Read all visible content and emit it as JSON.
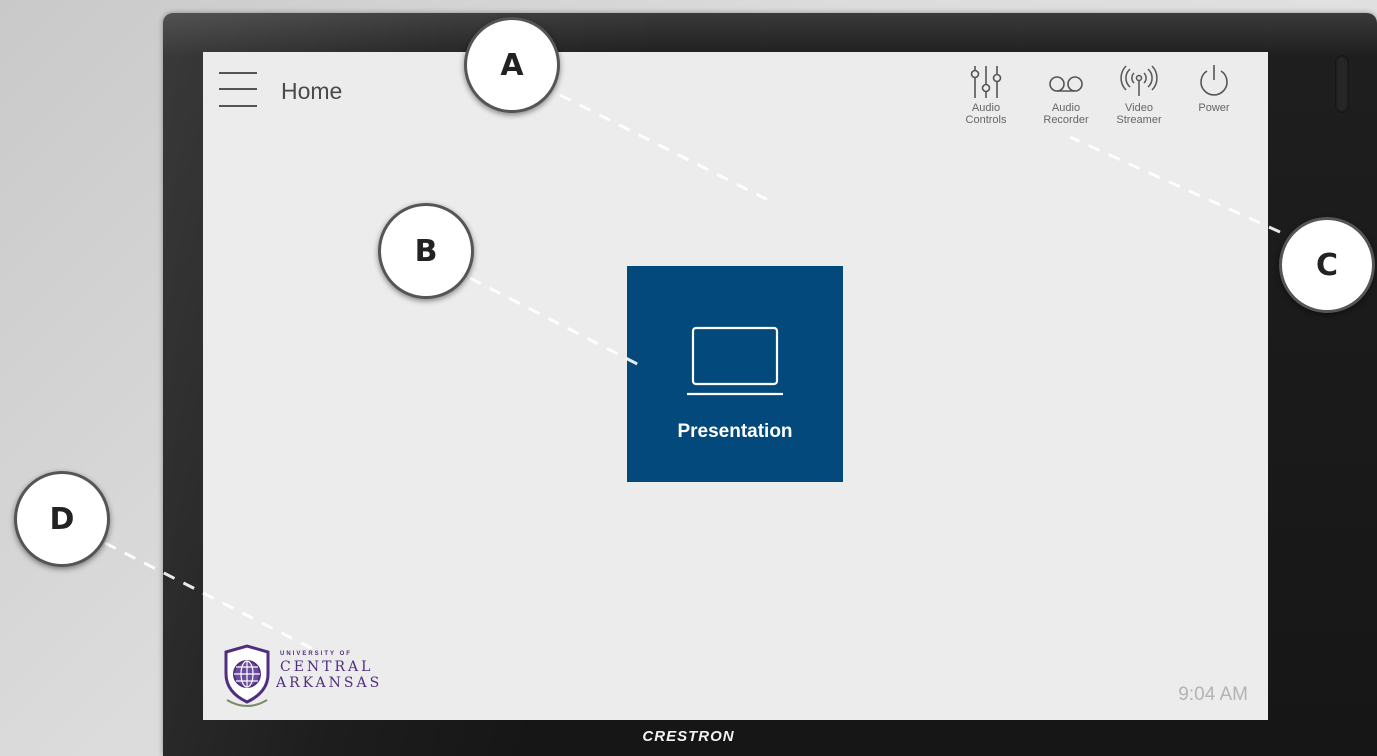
{
  "screen": {
    "title": "Home",
    "time": "9:04 AM",
    "primary_tile": {
      "label": "Presentation",
      "icon": "laptop-icon"
    },
    "top_controls": [
      {
        "label": "Audio\nControls",
        "icon": "sliders-icon"
      },
      {
        "label": "Audio\nRecorder",
        "icon": "voicemail-icon"
      },
      {
        "label": "Video\nStreamer",
        "icon": "broadcast-icon"
      },
      {
        "label": "Power",
        "icon": "power-icon"
      }
    ],
    "logo": {
      "line1": "UNIVERSITY OF",
      "line2": "CENTRAL",
      "line3": "ARKANSAS"
    }
  },
  "device": {
    "brand": "CRESTRON"
  },
  "callouts": [
    "A",
    "B",
    "C",
    "D"
  ],
  "colors": {
    "tile": "#03497c",
    "logo": "#4f2d7f",
    "screen": "#ececec"
  }
}
